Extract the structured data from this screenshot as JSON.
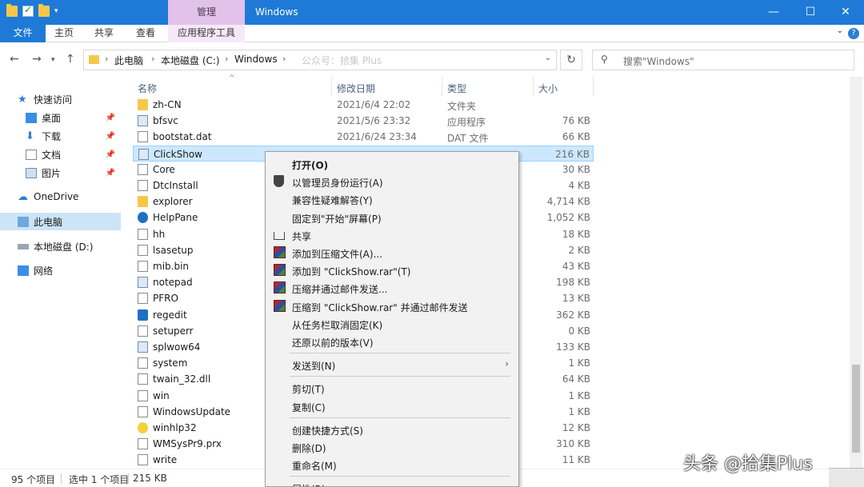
{
  "titlebar": {
    "context_tab": "管理",
    "title": "Windows",
    "minimize": "—",
    "maximize": "☐",
    "close": "✕"
  },
  "ribbon": {
    "tabs": [
      "文件",
      "主页",
      "共享",
      "查看",
      "应用程序工具"
    ]
  },
  "address": {
    "crumbs": [
      "此电脑",
      "本地磁盘 (C:)",
      "Windows"
    ],
    "watermark": "公众号：拾集 Plus",
    "search_placeholder": "搜索\"Windows\""
  },
  "sidebar": {
    "quick_access": "快速访问",
    "items": [
      "桌面",
      "下载",
      "文档",
      "图片"
    ],
    "onedrive": "OneDrive",
    "this_pc": "此电脑",
    "local_disk_d": "本地磁盘 (D:)",
    "network": "网络"
  },
  "columns": {
    "name": "名称",
    "date": "修改日期",
    "type": "类型",
    "size": "大小"
  },
  "files": [
    {
      "name": "zh-CN",
      "date": "2021/6/4 22:02",
      "type": "文件夹",
      "size": "",
      "icon": "folder"
    },
    {
      "name": "bfsvc",
      "date": "2021/5/6 23:32",
      "type": "应用程序",
      "size": "76 KB",
      "icon": "app"
    },
    {
      "name": "bootstat.dat",
      "date": "2021/6/24 23:34",
      "type": "DAT 文件",
      "size": "66 KB",
      "icon": "file"
    },
    {
      "name": "ClickShow",
      "date": "",
      "type": "",
      "size": "216 KB",
      "icon": "app"
    },
    {
      "name": "Core",
      "date": "",
      "type": "",
      "size": "30 KB",
      "icon": "file"
    },
    {
      "name": "DtcInstall",
      "date": "",
      "type": "",
      "size": "4 KB",
      "icon": "file"
    },
    {
      "name": "explorer",
      "date": "",
      "type": "",
      "size": "4,714 KB",
      "icon": "folder"
    },
    {
      "name": "HelpPane",
      "date": "",
      "type": "",
      "size": "1,052 KB",
      "icon": "help"
    },
    {
      "name": "hh",
      "date": "",
      "type": "",
      "size": "18 KB",
      "icon": "file"
    },
    {
      "name": "lsasetup",
      "date": "",
      "type": "",
      "size": "2 KB",
      "icon": "file"
    },
    {
      "name": "mib.bin",
      "date": "",
      "type": "",
      "size": "43 KB",
      "icon": "file"
    },
    {
      "name": "notepad",
      "date": "",
      "type": "",
      "size": "198 KB",
      "icon": "app"
    },
    {
      "name": "PFRO",
      "date": "",
      "type": "",
      "size": "13 KB",
      "icon": "file"
    },
    {
      "name": "regedit",
      "date": "",
      "type": "",
      "size": "362 KB",
      "icon": "blue"
    },
    {
      "name": "setuperr",
      "date": "",
      "type": "",
      "size": "0 KB",
      "icon": "file"
    },
    {
      "name": "splwow64",
      "date": "",
      "type": "",
      "size": "133 KB",
      "icon": "app"
    },
    {
      "name": "system",
      "date": "",
      "type": "",
      "size": "1 KB",
      "icon": "file"
    },
    {
      "name": "twain_32.dll",
      "date": "",
      "type": "",
      "size": "64 KB",
      "icon": "file"
    },
    {
      "name": "win",
      "date": "",
      "type": "",
      "size": "1 KB",
      "icon": "file"
    },
    {
      "name": "WindowsUpdate",
      "date": "",
      "type": "",
      "size": "1 KB",
      "icon": "file"
    },
    {
      "name": "winhlp32",
      "date": "",
      "type": "",
      "size": "12 KB",
      "icon": "yellow"
    },
    {
      "name": "WMSysPr9.prx",
      "date": "",
      "type": "",
      "size": "310 KB",
      "icon": "file"
    },
    {
      "name": "write",
      "date": "",
      "type": "",
      "size": "11 KB",
      "icon": "file"
    }
  ],
  "context_menu": [
    {
      "label": "打开(O)",
      "bold": true,
      "icon": ""
    },
    {
      "label": "以管理员身份运行(A)",
      "icon": "shield"
    },
    {
      "label": "兼容性疑难解答(Y)",
      "icon": ""
    },
    {
      "label": "固定到\"开始\"屏幕(P)",
      "icon": ""
    },
    {
      "label": "共享",
      "icon": "share"
    },
    {
      "label": "添加到压缩文件(A)...",
      "icon": "rar"
    },
    {
      "label": "添加到 \"ClickShow.rar\"(T)",
      "icon": "rar"
    },
    {
      "label": "压缩并通过邮件发送...",
      "icon": "rar"
    },
    {
      "label": "压缩到 \"ClickShow.rar\" 并通过邮件发送",
      "icon": "rar"
    },
    {
      "label": "从任务栏取消固定(K)",
      "icon": ""
    },
    {
      "label": "还原以前的版本(V)",
      "icon": ""
    },
    {
      "label": "发送到(N)",
      "icon": "",
      "submenu": true
    },
    {
      "label": "剪切(T)",
      "icon": ""
    },
    {
      "label": "复制(C)",
      "icon": ""
    },
    {
      "label": "创建快捷方式(S)",
      "icon": ""
    },
    {
      "label": "删除(D)",
      "icon": ""
    },
    {
      "label": "重命名(M)",
      "icon": ""
    },
    {
      "label": "属性(R)",
      "icon": ""
    }
  ],
  "status": {
    "count": "95 个项目",
    "selected": "选中 1 个项目",
    "size": "215 KB"
  },
  "watermark": "头条 @拾集Plus"
}
